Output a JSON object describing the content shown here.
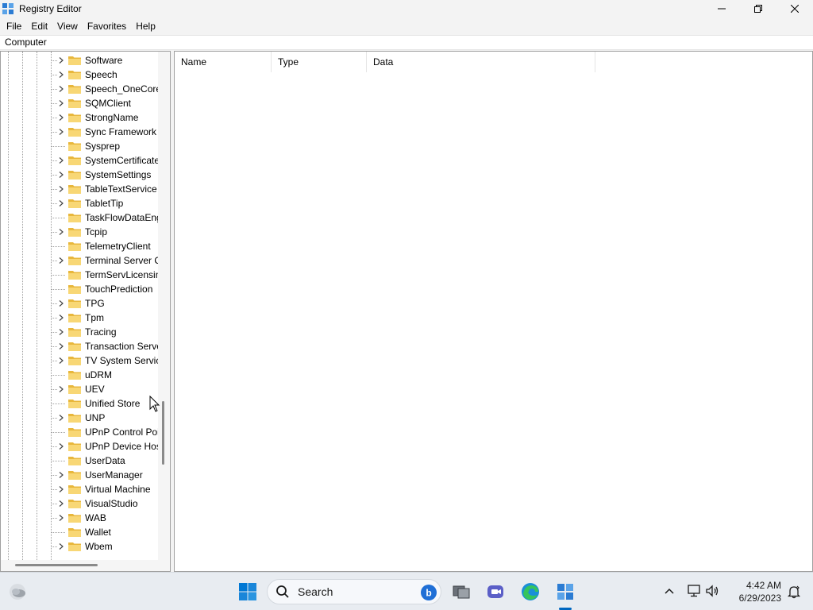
{
  "window": {
    "title": "Registry Editor",
    "icons": {
      "app": "registry-editor-icon",
      "minimize": "minimize-icon",
      "maximize": "restore-icon",
      "close": "close-icon"
    }
  },
  "menu": {
    "items": [
      "File",
      "Edit",
      "View",
      "Favorites",
      "Help"
    ]
  },
  "address": {
    "path": "Computer"
  },
  "tree": {
    "items": [
      {
        "label": "Software",
        "expandable": true
      },
      {
        "label": "Speech",
        "expandable": true
      },
      {
        "label": "Speech_OneCore",
        "expandable": true
      },
      {
        "label": "SQMClient",
        "expandable": true
      },
      {
        "label": "StrongName",
        "expandable": true
      },
      {
        "label": "Sync Framework",
        "expandable": true
      },
      {
        "label": "Sysprep",
        "expandable": false
      },
      {
        "label": "SystemCertificate",
        "expandable": true
      },
      {
        "label": "SystemSettings",
        "expandable": true
      },
      {
        "label": "TableTextService",
        "expandable": true
      },
      {
        "label": "TabletTip",
        "expandable": true
      },
      {
        "label": "TaskFlowDataEng",
        "expandable": false
      },
      {
        "label": "Tcpip",
        "expandable": true
      },
      {
        "label": "TelemetryClient",
        "expandable": false
      },
      {
        "label": "Terminal Server C",
        "expandable": true
      },
      {
        "label": "TermServLicensin",
        "expandable": false
      },
      {
        "label": "TouchPrediction",
        "expandable": false
      },
      {
        "label": "TPG",
        "expandable": true
      },
      {
        "label": "Tpm",
        "expandable": true
      },
      {
        "label": "Tracing",
        "expandable": true
      },
      {
        "label": "Transaction Serve",
        "expandable": true
      },
      {
        "label": "TV System Service",
        "expandable": true
      },
      {
        "label": "uDRM",
        "expandable": false
      },
      {
        "label": "UEV",
        "expandable": true
      },
      {
        "label": "Unified Store",
        "expandable": false
      },
      {
        "label": "UNP",
        "expandable": true
      },
      {
        "label": "UPnP Control Poi",
        "expandable": false
      },
      {
        "label": "UPnP Device Hos",
        "expandable": true
      },
      {
        "label": "UserData",
        "expandable": false
      },
      {
        "label": "UserManager",
        "expandable": true
      },
      {
        "label": "Virtual Machine",
        "expandable": true
      },
      {
        "label": "VisualStudio",
        "expandable": true
      },
      {
        "label": "WAB",
        "expandable": true
      },
      {
        "label": "Wallet",
        "expandable": false
      },
      {
        "label": "Wbem",
        "expandable": true
      }
    ]
  },
  "values": {
    "columns": [
      "Name",
      "Type",
      "Data"
    ]
  },
  "taskbar": {
    "search_label": "Search",
    "icons": [
      "weather-icon",
      "start-icon",
      "search-icon",
      "bing-icon",
      "task-view-icon",
      "chat-icon",
      "edge-icon",
      "regedit-icon"
    ],
    "tray_icons": [
      "chevron-up-icon",
      "network-icon",
      "volume-icon",
      "notification-icon"
    ],
    "time": "4:42 AM",
    "date": "6/29/2023"
  },
  "colors": {
    "accent": "#0067c0",
    "folder": "#f8d775"
  }
}
